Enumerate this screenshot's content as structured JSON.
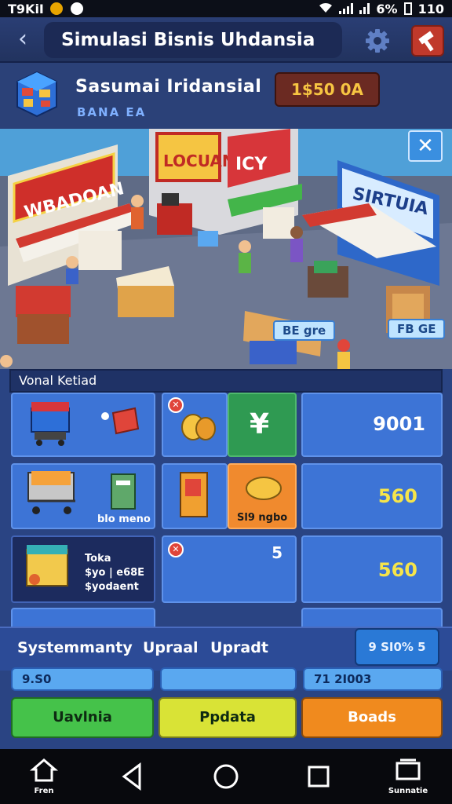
{
  "status_bar": {
    "carrier": "T9KiI",
    "battery": "6%",
    "time": "110"
  },
  "header": {
    "title": "Simulasi Bisnis Uhdansia"
  },
  "profile": {
    "shop_name": "Sasumai Iridansial",
    "subtitle": "BANA EA",
    "money": "1$50 0A"
  },
  "scene": {
    "signs": {
      "left": "WBADOAN",
      "center": "LOCUAN",
      "center_side": "ICY",
      "right": "SIRTUIA"
    },
    "tags": {
      "mid": "BE gre",
      "right": "FB GE"
    }
  },
  "section": {
    "title": "Vonal Ketiad"
  },
  "grid": {
    "row1": {
      "value": "9001"
    },
    "row2": {
      "item_label": "blo meno",
      "item2_label": "Sl9 ngbo",
      "value": "560"
    },
    "row3": {
      "info_lines": [
        "Toka",
        "$yo | e68E",
        "$yodaent"
      ],
      "count": "5",
      "value": "560"
    }
  },
  "upgrade": {
    "label1": "Systemmanty",
    "label2": "Upraal",
    "label3": "Upradt",
    "badge": "9 SI0% 5"
  },
  "stats": {
    "left": "9.S0",
    "middle": "",
    "right": "71 2I003"
  },
  "actions": {
    "green": "Uavlnia",
    "yellow": "Ppdata",
    "orange": "Boads"
  },
  "nav": {
    "home": "Fren",
    "menu": "Sunnatie"
  }
}
